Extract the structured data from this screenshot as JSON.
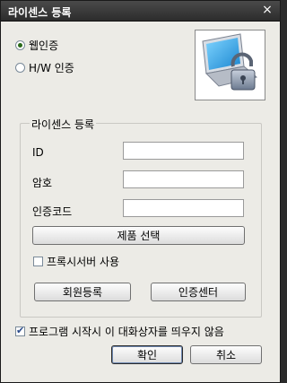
{
  "window": {
    "title": "라이센스 등록",
    "close_symbol": "×"
  },
  "auth_mode": {
    "options": [
      {
        "label": "웹인증",
        "selected": true
      },
      {
        "label": "H/W 인증",
        "selected": false
      }
    ]
  },
  "image": {
    "icon": "laptop-lock-icon"
  },
  "license_group": {
    "title": "라이센스 등록",
    "fields": [
      {
        "label": "ID",
        "value": ""
      },
      {
        "label": "암호",
        "value": ""
      },
      {
        "label": "인증코드",
        "value": ""
      }
    ],
    "product_select_label": "제품 선택",
    "proxy_checkbox": {
      "label": "프록시서버 사용",
      "checked": false
    },
    "register_member_label": "회원등록",
    "auth_center_label": "인증센터"
  },
  "startup_checkbox": {
    "label": "프로그램 시작시 이 대화상자를 띄우지 않음",
    "checked": true
  },
  "ok_label": "확인",
  "cancel_label": "취소",
  "colors": {
    "titlebar": "#2c2c2c",
    "window_bg": "#ecebe6",
    "screen_blue": "#1aa0e0"
  }
}
